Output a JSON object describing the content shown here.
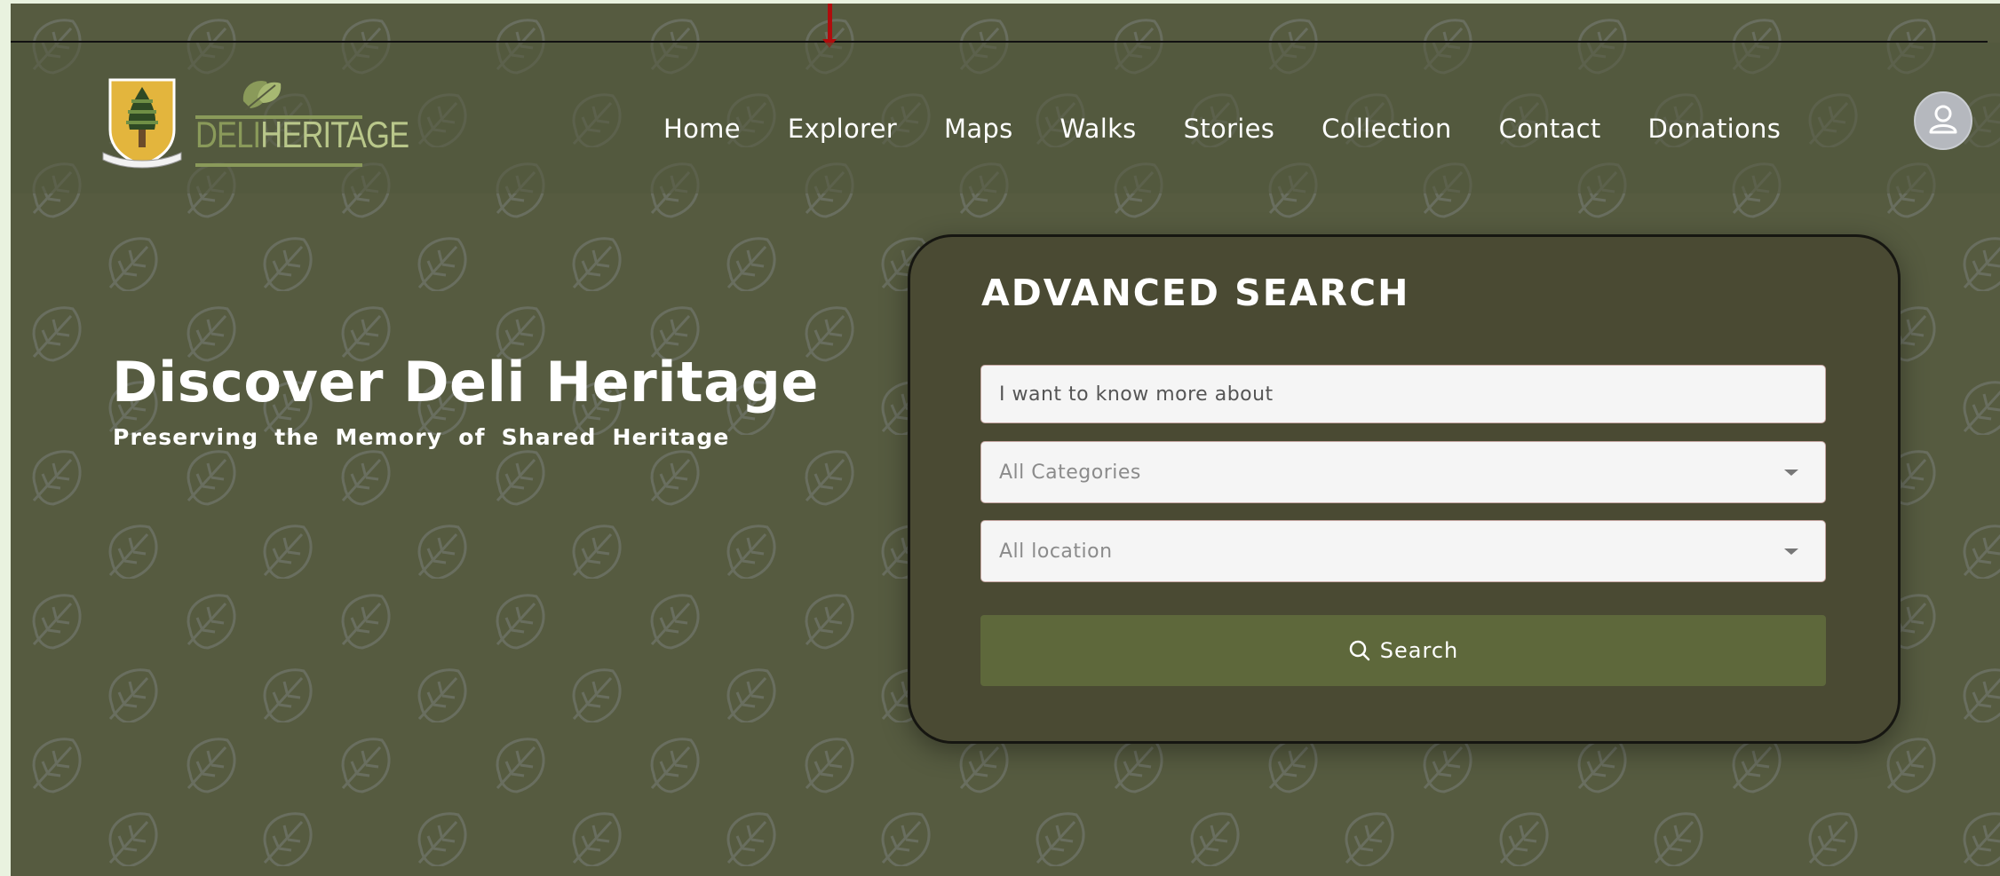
{
  "brand": {
    "name_part1": "DELI",
    "name_part2": "HERITAGE"
  },
  "nav": {
    "items": [
      {
        "label": "Home"
      },
      {
        "label": "Explorer"
      },
      {
        "label": "Maps"
      },
      {
        "label": "Walks"
      },
      {
        "label": "Stories"
      },
      {
        "label": "Collection"
      },
      {
        "label": "Contact"
      },
      {
        "label": "Donations"
      }
    ]
  },
  "hero": {
    "title": "Discover Deli Heritage",
    "subtitle": "Preserving the Memory of Shared Heritage"
  },
  "search": {
    "title": "ADVANCED SEARCH",
    "query_placeholder": "I want to know more about",
    "category_value": "All Categories",
    "location_value": "All location",
    "button_label": "Search"
  },
  "icons": {
    "avatar": "user-icon",
    "search": "search-icon",
    "dropdown": "chevron-down-icon",
    "background": "leaf-pattern"
  },
  "colors": {
    "background": "#565b40",
    "card": "#4a4a33",
    "button": "#5e683b",
    "logo_green": "#8a9a5a"
  }
}
